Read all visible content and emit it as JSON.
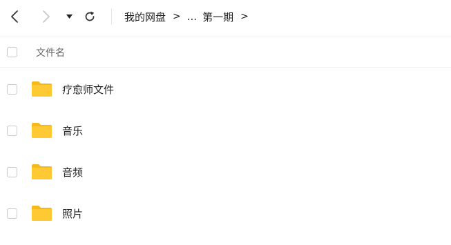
{
  "toolbar": {
    "back_icon": "chevron-left-icon",
    "forward_icon": "chevron-right-icon",
    "history_icon": "caret-down-icon",
    "refresh_icon": "refresh-icon"
  },
  "breadcrumb": {
    "root": "我的网盘",
    "separator": ">",
    "ellipsis": "...",
    "current": "第一期"
  },
  "list_header": {
    "name_column": "文件名"
  },
  "files": [
    {
      "name": "疗愈师文件",
      "type": "folder",
      "icon": "folder-icon"
    },
    {
      "name": "音乐",
      "type": "folder",
      "icon": "folder-icon"
    },
    {
      "name": "音频",
      "type": "folder",
      "icon": "folder-icon"
    },
    {
      "name": "照片",
      "type": "folder",
      "icon": "folder-icon"
    }
  ],
  "colors": {
    "folder": "#FFC933",
    "folder_tab": "#F5B91E",
    "text": "#222222",
    "muted_text": "#666666",
    "border": "#f0f0f0",
    "disabled_icon": "#c8c8c8"
  }
}
